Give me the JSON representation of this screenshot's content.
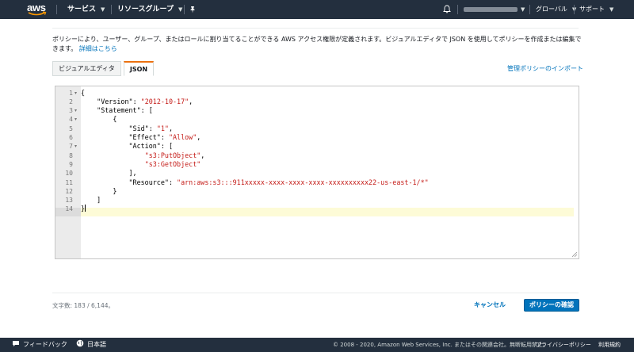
{
  "header": {
    "services_label": "サービス",
    "resource_groups_label": "リソースグループ",
    "region_label": "グローバル",
    "support_label": "サポート",
    "logo_text": "aws"
  },
  "main": {
    "description": "ポリシーにより、ユーザー、グループ、またはロールに割り当てることができる AWS アクセス権限が定義されます。ビジュアルエディタで JSON を使用してポリシーを作成または編集できます。",
    "learn_more": "詳細はこちら",
    "tabs": [
      {
        "label": "ビジュアルエディタ",
        "active": false
      },
      {
        "label": "JSON",
        "active": true
      }
    ],
    "import_link": "管理ポリシーのインポート",
    "editor": {
      "lines": [
        "{",
        "    \"Version\": \"2012-10-17\",",
        "    \"Statement\": [",
        "        {",
        "            \"Sid\": \"1\",",
        "            \"Effect\": \"Allow\",",
        "            \"Action\": [",
        "                \"s3:PutObject\",",
        "                \"s3:GetObject\"",
        "            ],",
        "            \"Resource\": \"arn:aws:s3:::911xxxxx-xxxx-xxxx-xxxx-xxxxxxxxxx22-us-east-1/*\"",
        "        }",
        "    ]",
        "}"
      ],
      "fold_lines": [
        1,
        3,
        4,
        7
      ],
      "active_line": 14
    },
    "char_count": "文字数: 183 / 6,144。",
    "cancel_label": "キャンセル",
    "confirm_label": "ポリシーの確認"
  },
  "footer": {
    "feedback_label": "フィードバック",
    "language_label": "日本語",
    "copyright": "© 2008 - 2020, Amazon Web Services, Inc. またはその関連会社。無断転用禁止。",
    "privacy_label": "プライバシーポリシー",
    "terms_label": "利用規約"
  },
  "colors": {
    "nav_bg": "#232f3e",
    "accent": "#ec7211",
    "link": "#0073bb",
    "string": "#c41a16"
  }
}
